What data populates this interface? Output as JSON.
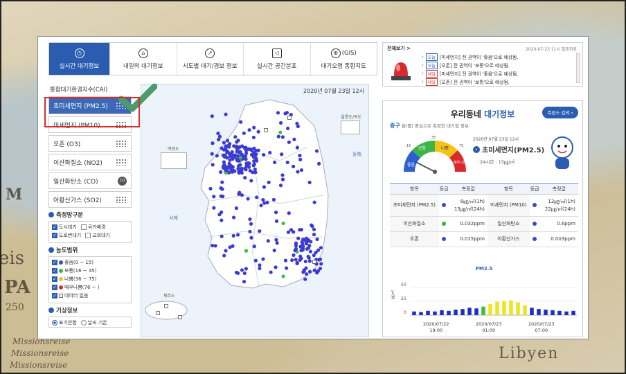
{
  "background": {
    "words": [
      "M",
      "eis",
      "PA",
      "250",
      "Missionsreise",
      "Missionsreise",
      "Missionsreise",
      "Libyen"
    ]
  },
  "tabs": [
    {
      "label": "실시간 대기정보",
      "icon": "clock-icon",
      "active": true
    },
    {
      "label": "내일의 대기정보",
      "icon": "house-icon"
    },
    {
      "label": "시도별 대기/경보 정보",
      "icon": "compass-icon"
    },
    {
      "label": "실시간 공간분포",
      "icon": "megaphone-icon"
    },
    {
      "label": "(GIS)",
      "label2": "대기오염 통합지도",
      "icon": "globe-icon"
    }
  ],
  "left": {
    "items": [
      {
        "label": "통합대기환경지수(CAI)"
      },
      {
        "label": "초미세먼지 (PM2.5)",
        "active": true
      },
      {
        "label": "미세먼지 (PM10)"
      },
      {
        "label": "오존 (O3)"
      },
      {
        "label": "이산화질소 (NO2)"
      },
      {
        "label": "일산화탄소 (CO)",
        "badge": "CO"
      },
      {
        "label": "아황산가스 (SO2)"
      }
    ],
    "station_title": "측정망구분",
    "stations": [
      {
        "label": "도시대기",
        "checked": true
      },
      {
        "label": "국가배경",
        "checked": false
      },
      {
        "label": "도로변대기",
        "checked": true
      },
      {
        "label": "교외대기",
        "checked": false
      }
    ],
    "range_title": "농도범위",
    "ranges": [
      {
        "label": "좋음(0 ~ 15)",
        "color": "#3b49c9"
      },
      {
        "label": "보통(16 ~ 35)",
        "color": "#37b34a"
      },
      {
        "label": "나쁨(36 ~ 75)",
        "color": "#f2c22c"
      },
      {
        "label": "매우나쁨(76 ~ )",
        "color": "#d8292f"
      },
      {
        "label": "데이터 없음",
        "color": "#999999"
      }
    ],
    "weather_title": "기상정보",
    "weather": [
      {
        "label": "표기안함",
        "checked": true
      },
      {
        "label": "날씨 기온",
        "checked": false
      }
    ]
  },
  "map": {
    "datetime": "2020년 07월 23일 12시",
    "labels": {
      "ulleung": "울릉도/독도",
      "baengnyeong": "백령도",
      "jeju": "제주도",
      "west_sea": "서해",
      "east_sea": "동해"
    }
  },
  "notice": {
    "title": "전체보기 >",
    "time": "2020-07-23 11시 발표자료",
    "items": [
      {
        "tag": "오늘",
        "style": "blue",
        "text": "[미세먼지] 전 권역이 '좋음'으로 예상됨."
      },
      {
        "tag": "오늘",
        "style": "blue",
        "text": "[오존] 전 권역이 '보통'으로 예상됨."
      },
      {
        "tag": "내일",
        "style": "red",
        "text": "[미세먼지] 전 권역이 '좋음'으로 예상됨."
      },
      {
        "tag": "내일",
        "style": "red",
        "text": "[오존] 전 권역이 '보통'으로 예상됨."
      }
    ]
  },
  "panel": {
    "title_a": "우리동네",
    "title_b": "대기정보",
    "search_label": "측정소 검색",
    "district": "중구",
    "district_desc": "을(를) 중심으로 측정한 대기질 정보",
    "gauge": {
      "labels": [
        "좋음",
        "보통",
        "나쁨",
        "매우나쁨"
      ],
      "ticks": [
        "15",
        "35",
        "75"
      ],
      "value": 15
    },
    "date": "2020년 07월 23일 12시",
    "pollutant": "초미세먼지(PM2.5)",
    "sub": "· 24시간 : 15㎍/㎥",
    "table": {
      "headers": [
        "항목",
        "등급",
        "측정값",
        "항목",
        "등급",
        "측정값"
      ],
      "rows": [
        {
          "n1": "초미세먼지 (PM2.5)",
          "c1": "#3b49c9",
          "v1a": "8㎍/㎥(1h)",
          "v1b": "15㎍/㎥(24h)",
          "n2": "미세먼지 (PM10)",
          "c2": "#3b49c9",
          "v2a": "12㎍/㎥(1h)",
          "v2b": "22㎍/㎥(24h)"
        },
        {
          "n1": "이산화질소",
          "c1": "#37b34a",
          "v1a": "0.032ppm",
          "n2": "일산화탄소",
          "c2": "#3b49c9",
          "v2a": "0.6ppm"
        },
        {
          "n1": "오존",
          "c1": "#3b49c9",
          "v1a": "0.015ppm",
          "n2": "아황산가스",
          "c2": "#3b49c9",
          "v2a": "0.003ppm"
        }
      ]
    }
  },
  "chart_data": {
    "type": "bar",
    "title": "PM2.5",
    "ylabel": "㎍/㎥",
    "yticks": [
      "50",
      "25",
      "0"
    ],
    "ylim": [
      0,
      60
    ],
    "xlabels": [
      "2020/07/22\n19:00",
      "2020/07/23\n01:00",
      "2020/07/23\n07:00"
    ],
    "values": [
      6,
      5,
      7,
      6,
      8,
      7,
      9,
      10,
      12,
      11,
      14,
      18,
      22,
      23,
      24,
      21,
      16,
      12,
      10,
      9,
      8,
      7,
      6,
      7
    ],
    "colors_by_level": {
      "good": "#1d2ec4",
      "moderate": "#3cbf3c",
      "bad": "#f2e322"
    }
  }
}
